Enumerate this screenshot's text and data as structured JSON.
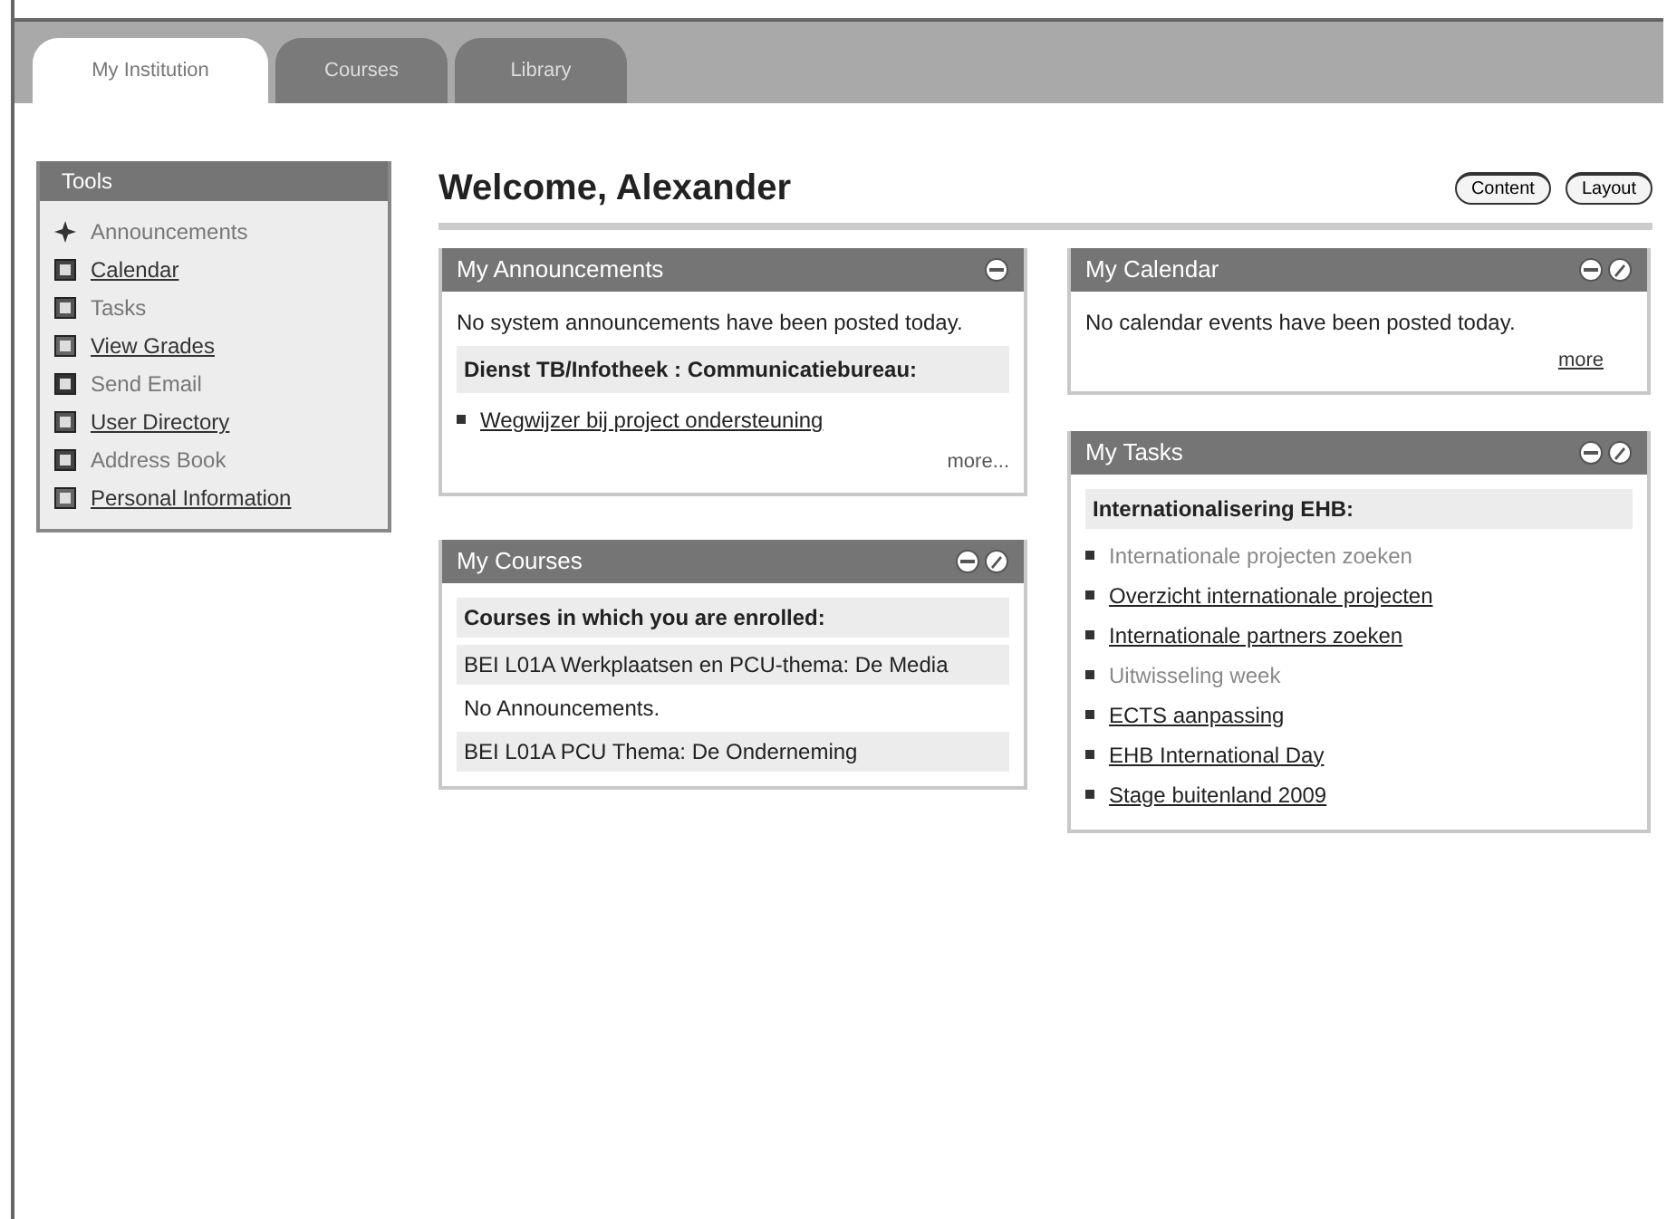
{
  "tabs": [
    {
      "label": "My Institution",
      "selected": true
    },
    {
      "label": "Courses",
      "selected": false
    },
    {
      "label": "Library",
      "selected": false
    }
  ],
  "tools": {
    "title": "Tools",
    "items": [
      {
        "label": "Announcements",
        "link": false
      },
      {
        "label": "Calendar",
        "link": true
      },
      {
        "label": "Tasks",
        "link": false
      },
      {
        "label": "View Grades",
        "link": true
      },
      {
        "label": "Send Email",
        "link": false
      },
      {
        "label": "User Directory",
        "link": true
      },
      {
        "label": "Address Book",
        "link": false
      },
      {
        "label": "Personal Information",
        "link": true
      }
    ]
  },
  "welcome": "Welcome, Alexander",
  "header_buttons": [
    "Content",
    "Layout"
  ],
  "announcements": {
    "title": "My Announcements",
    "text": "No system announcements have been posted today.",
    "group": "Dienst TB/Infotheek : Communicatiebureau:",
    "links": [
      "Wegwijzer bij project ondersteuning"
    ],
    "more": "more..."
  },
  "courses": {
    "title": "My Courses",
    "heading": "Courses in which you are enrolled:",
    "entries": [
      {
        "kind": "course",
        "text": "BEI L01A Werkplaatsen en PCU-thema: De Media"
      },
      {
        "kind": "note",
        "text": "No Announcements."
      },
      {
        "kind": "course",
        "text": "BEI L01A PCU Thema: De Onderneming"
      }
    ]
  },
  "calendar": {
    "title": "My Calendar",
    "text": "No calendar events have been posted today.",
    "more": "more"
  },
  "tasks": {
    "title": "My Tasks",
    "heading": "Internationalisering EHB:",
    "items": [
      {
        "label": "Internationale projecten zoeken",
        "link": false
      },
      {
        "label": "Overzicht internationale projecten",
        "link": true
      },
      {
        "label": "Internationale partners zoeken",
        "link": true
      },
      {
        "label": "Uitwisseling week",
        "link": false
      },
      {
        "label": "ECTS aanpassing",
        "link": true
      },
      {
        "label": "EHB International Day",
        "link": true
      },
      {
        "label": "Stage buitenland 2009",
        "link": true
      }
    ]
  }
}
